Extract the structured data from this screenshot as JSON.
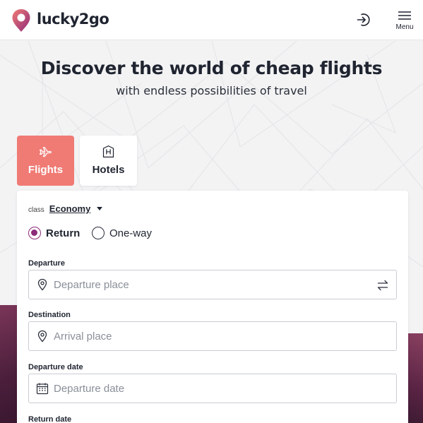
{
  "header": {
    "brand": "lucky2go",
    "logo_icon": "location-pin-logo",
    "login_icon": "sign-in-icon",
    "menu_label": "Menu"
  },
  "hero": {
    "title": "Discover the world of cheap flights",
    "subtitle": "with endless possibilities of travel"
  },
  "tabs": [
    {
      "label": "Flights",
      "icon": "airplane-icon",
      "active": true
    },
    {
      "label": "Hotels",
      "icon": "hotel-icon",
      "active": false
    }
  ],
  "search": {
    "class_label": "class",
    "class_value": "Economy",
    "trip_types": [
      {
        "label": "Return",
        "selected": true
      },
      {
        "label": "One-way",
        "selected": false
      }
    ],
    "fields": [
      {
        "label": "Departure",
        "placeholder": "Departure place",
        "icon": "location-pin-icon"
      },
      {
        "label": "Destination",
        "placeholder": "Arrival place",
        "icon": "location-pin-icon"
      },
      {
        "label": "Departure date",
        "placeholder": "Departure date",
        "icon": "calendar-icon"
      },
      {
        "label": "Return date"
      }
    ]
  },
  "colors": {
    "accent": "#f07a74",
    "radio": "#8e2a7a",
    "text": "#1f2430",
    "placeholder": "#8a8f99"
  }
}
